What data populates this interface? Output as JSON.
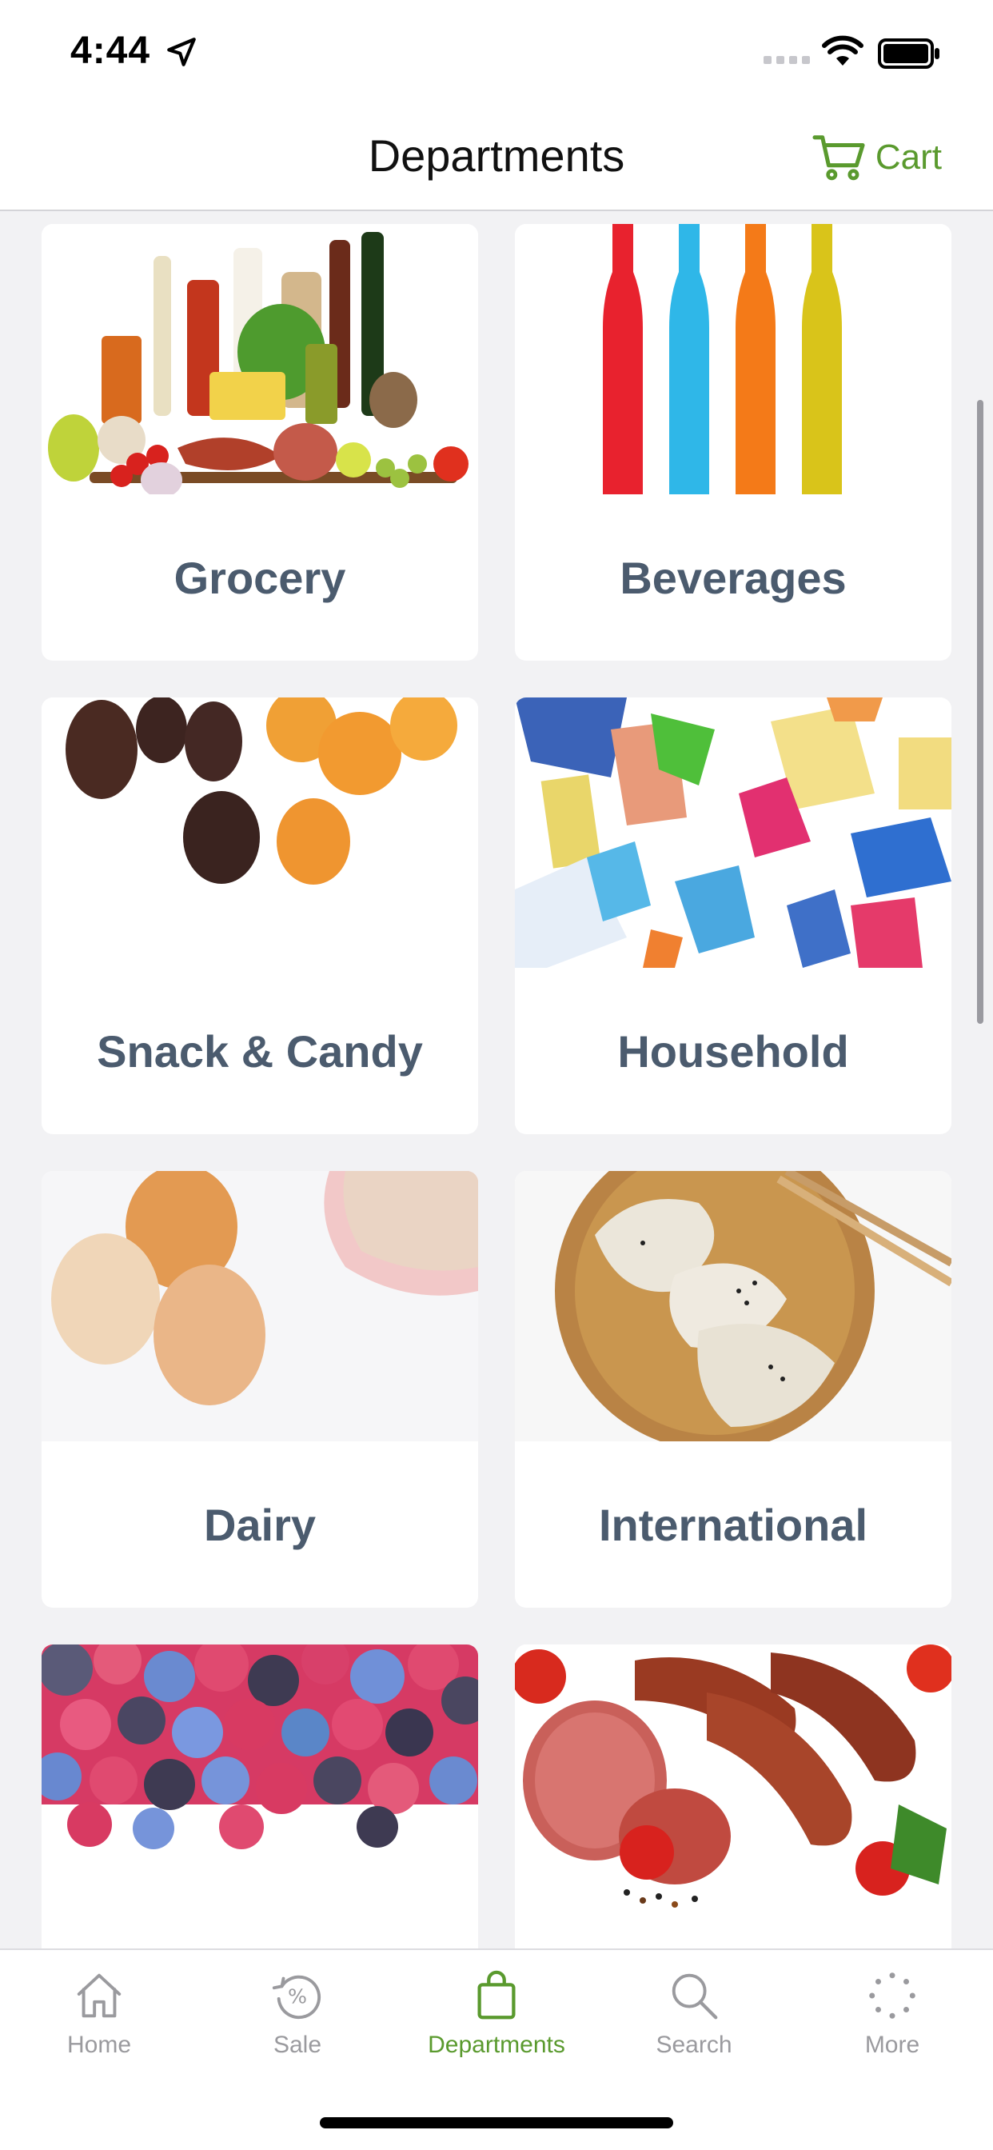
{
  "status_bar": {
    "time": "4:44"
  },
  "nav": {
    "title": "Departments",
    "cart_label": "Cart"
  },
  "departments": [
    {
      "label": "Grocery",
      "image": "grocery-image"
    },
    {
      "label": "Beverages",
      "image": "beverages-image"
    },
    {
      "label": "Snack & Candy",
      "image": "snack-candy-image"
    },
    {
      "label": "Household",
      "image": "household-image"
    },
    {
      "label": "Dairy",
      "image": "dairy-image"
    },
    {
      "label": "International",
      "image": "international-image"
    },
    {
      "label": "",
      "image": "berries-image"
    },
    {
      "label": "",
      "image": "meat-image"
    }
  ],
  "tabs": [
    {
      "label": "Home",
      "icon": "home-icon"
    },
    {
      "label": "Sale",
      "icon": "sale-icon"
    },
    {
      "label": "Departments",
      "icon": "bag-icon",
      "active": true
    },
    {
      "label": "Search",
      "icon": "search-icon"
    },
    {
      "label": "More",
      "icon": "more-icon"
    }
  ],
  "colors": {
    "accent": "#5a9a2e",
    "label": "#4b5b6e",
    "inactive": "#9a9a9e"
  }
}
